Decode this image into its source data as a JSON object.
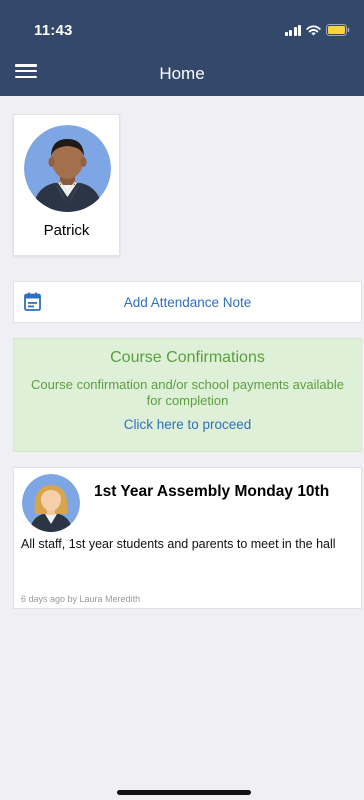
{
  "status_bar": {
    "time": "11:43"
  },
  "nav": {
    "title": "Home"
  },
  "profile": {
    "name": "Patrick"
  },
  "attendance": {
    "label": "Add Attendance Note"
  },
  "course": {
    "title": "Course Confirmations",
    "description": "Course confirmation and/or school payments available for completion",
    "link": "Click here to proceed"
  },
  "news": {
    "title": "1st Year Assembly Monday 10th",
    "body": "All staff, 1st year students and parents to meet in the hall",
    "meta": "6 days ago by Laura Meredith"
  },
  "colors": {
    "header": "#33486b",
    "link": "#2e6fbf",
    "success_bg": "#dff0d8",
    "success_text": "#5a9f3e",
    "battery": "#f7d43a"
  },
  "icons": [
    "menu-icon",
    "calendar-icon",
    "signal-icon",
    "wifi-icon",
    "battery-icon"
  ]
}
